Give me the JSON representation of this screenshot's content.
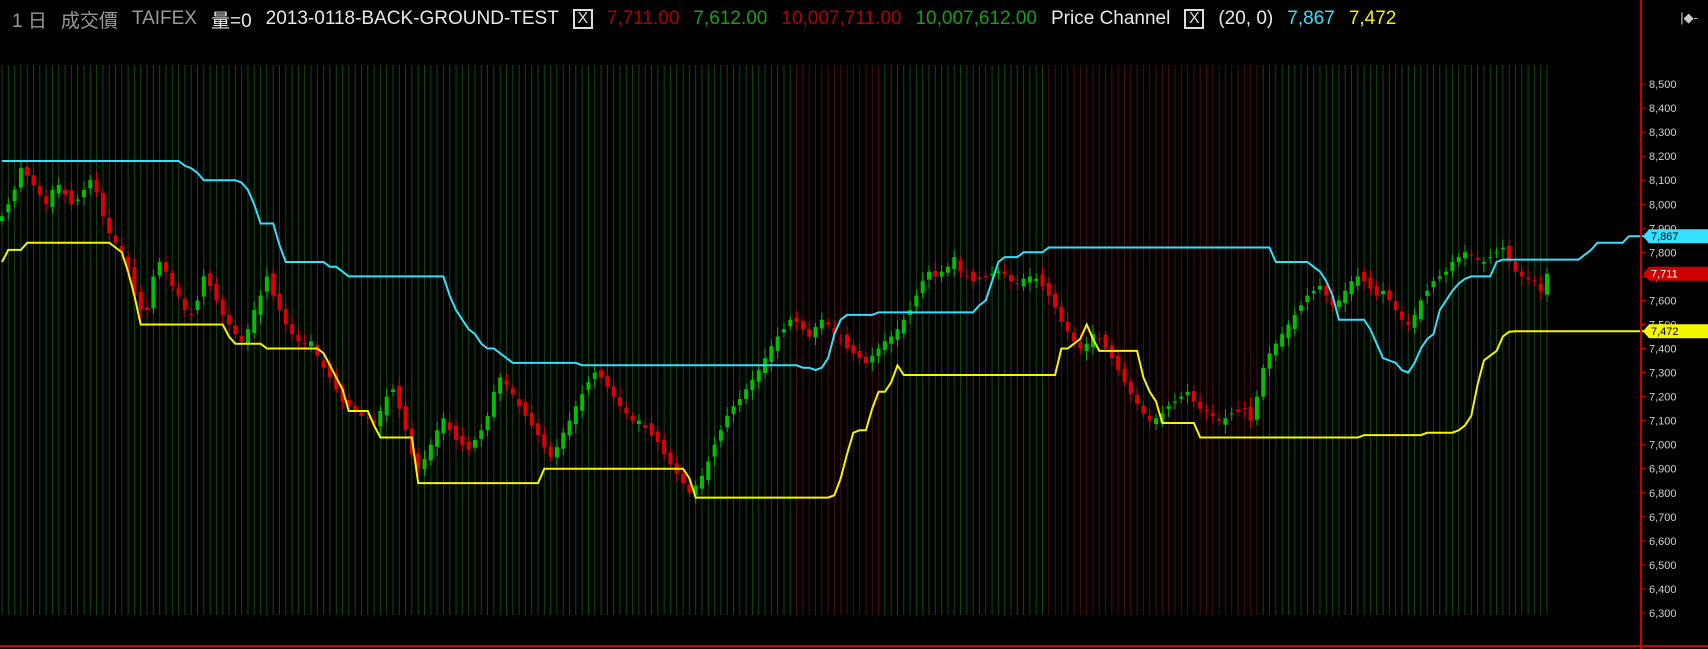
{
  "header": {
    "period": "1 日",
    "price_type": "成交價",
    "symbol": "TAIFEX",
    "volume": "量=0",
    "study1_name": "2013-0118-BACK-GROUND-TEST",
    "study1_close_box": "X",
    "study1_v1": "7,711.00",
    "study1_v2": "7,612.00",
    "study1_v3": "10,007,711.00",
    "study1_v4": "10,007,612.00",
    "study2_name": "Price Channel",
    "study2_close_box": "X",
    "study2_params": "(20,  0)",
    "study2_upper": "7,867",
    "study2_lower": "7,472"
  },
  "corner_label": "|◆-",
  "colors": {
    "up": "#00c000",
    "down": "#e00000",
    "upper_channel": "#33e0ff",
    "lower_channel": "#f5f500",
    "grid_green": "#0f4a12",
    "grid_red": "#4a1010",
    "axis": "#cc0000",
    "tick_text": "#cfcfcf",
    "header_red": "#b10000",
    "header_green": "#14a014",
    "header_white": "#e8e8e8",
    "header_gray": "#9a9a9a"
  },
  "chart_data": {
    "type": "candlestick",
    "ylim": [
      6250,
      8600
    ],
    "yticks": [
      "8,500",
      "8,400",
      "8,300",
      "8,200",
      "8,100",
      "8,000",
      "7,900",
      "7,800",
      "7,700",
      "7,600",
      "7,500",
      "7,400",
      "7,300",
      "7,200",
      "7,100",
      "7,000",
      "6,900",
      "6,800",
      "6,700",
      "6,600",
      "6,500",
      "6,400",
      "6,300"
    ],
    "ytick_values": [
      8500,
      8400,
      8300,
      8200,
      8100,
      8000,
      7900,
      7800,
      7700,
      7600,
      7500,
      7400,
      7300,
      7200,
      7100,
      7000,
      6900,
      6800,
      6700,
      6600,
      6500,
      6400,
      6300
    ],
    "closes": [
      7950,
      8000,
      8060,
      8150,
      8120,
      8080,
      8040,
      8000,
      8060,
      8080,
      8040,
      8000,
      8020,
      8060,
      8100,
      8050,
      7950,
      7880,
      7840,
      7800,
      7720,
      7620,
      7560,
      7560,
      7700,
      7760,
      7720,
      7660,
      7620,
      7560,
      7540,
      7600,
      7700,
      7660,
      7600,
      7540,
      7500,
      7460,
      7430,
      7480,
      7560,
      7620,
      7700,
      7620,
      7560,
      7500,
      7460,
      7430,
      7420,
      7430,
      7370,
      7320,
      7280,
      7230,
      7180,
      7160,
      7140,
      7120,
      7110,
      7090,
      7140,
      7200,
      7230,
      7150,
      7060,
      6960,
      6900,
      6940,
      7000,
      7060,
      7110,
      7060,
      7020,
      7000,
      6980,
      7020,
      7060,
      7120,
      7220,
      7280,
      7250,
      7210,
      7160,
      7120,
      7080,
      7040,
      6990,
      6950,
      6990,
      7050,
      7100,
      7160,
      7210,
      7260,
      7300,
      7280,
      7240,
      7200,
      7160,
      7130,
      7100,
      7100,
      7070,
      7040,
      7010,
      6960,
      6920,
      6880,
      6840,
      6800,
      6830,
      6870,
      6930,
      7000,
      7060,
      7120,
      7160,
      7190,
      7230,
      7270,
      7310,
      7360,
      7410,
      7450,
      7480,
      7520,
      7510,
      7480,
      7450,
      7490,
      7520,
      7500,
      7460,
      7440,
      7400,
      7380,
      7360,
      7340,
      7370,
      7400,
      7430,
      7450,
      7480,
      7520,
      7560,
      7620,
      7680,
      7720,
      7700,
      7720,
      7740,
      7780,
      7720,
      7700,
      7680,
      7690,
      7700,
      7710,
      7720,
      7710,
      7680,
      7670,
      7690,
      7700,
      7690,
      7660,
      7620,
      7570,
      7510,
      7470,
      7430,
      7400,
      7420,
      7460,
      7440,
      7400,
      7360,
      7310,
      7260,
      7210,
      7170,
      7130,
      7100,
      7110,
      7130,
      7160,
      7180,
      7200,
      7220,
      7180,
      7150,
      7140,
      7120,
      7100,
      7110,
      7130,
      7140,
      7150,
      7100,
      7200,
      7320,
      7380,
      7420,
      7460,
      7500,
      7540,
      7580,
      7620,
      7640,
      7660,
      7620,
      7580,
      7600,
      7640,
      7680,
      7700,
      7680,
      7650,
      7620,
      7640,
      7600,
      7560,
      7520,
      7500,
      7540,
      7600,
      7640,
      7680,
      7700,
      7720,
      7760,
      7780,
      7800,
      7790,
      7770,
      7760,
      7780,
      7800,
      7820,
      7760,
      7720,
      7700,
      7690,
      7680,
      7640,
      7711
    ],
    "upper": [
      8180,
      8180,
      8180,
      8180,
      8180,
      8180,
      8180,
      8180,
      8180,
      8180,
      8180,
      8180,
      8180,
      8180,
      8180,
      8180,
      8180,
      8180,
      8180,
      8180,
      8180,
      8180,
      8180,
      8180,
      8180,
      8180,
      8180,
      8180,
      8180,
      8160,
      8150,
      8130,
      8100,
      8100,
      8100,
      8100,
      8100,
      8100,
      8090,
      8060,
      8000,
      7920,
      7920,
      7920,
      7830,
      7760,
      7760,
      7760,
      7760,
      7760,
      7760,
      7760,
      7740,
      7740,
      7720,
      7700,
      7700,
      7700,
      7700,
      7700,
      7700,
      7700,
      7700,
      7700,
      7700,
      7700,
      7700,
      7700,
      7700,
      7700,
      7700,
      7620,
      7560,
      7520,
      7480,
      7460,
      7420,
      7400,
      7400,
      7380,
      7360,
      7340,
      7340,
      7340,
      7340,
      7340,
      7340,
      7340,
      7340,
      7340,
      7340,
      7340,
      7330,
      7330,
      7330,
      7330,
      7330,
      7330,
      7330,
      7330,
      7330,
      7330,
      7330,
      7330,
      7330,
      7330,
      7330,
      7330,
      7330,
      7330,
      7330,
      7330,
      7330,
      7330,
      7330,
      7330,
      7330,
      7330,
      7330,
      7330,
      7330,
      7330,
      7330,
      7330,
      7330,
      7330,
      7330,
      7320,
      7320,
      7310,
      7320,
      7360,
      7460,
      7520,
      7540,
      7540,
      7540,
      7540,
      7540,
      7550,
      7550,
      7550,
      7550,
      7550,
      7550,
      7550,
      7550,
      7550,
      7550,
      7550,
      7550,
      7550,
      7550,
      7550,
      7550,
      7580,
      7600,
      7680,
      7760,
      7780,
      7780,
      7780,
      7800,
      7800,
      7800,
      7800,
      7820,
      7820,
      7820,
      7820,
      7820,
      7820,
      7820,
      7820,
      7820,
      7820,
      7820,
      7820,
      7820,
      7820,
      7820,
      7820,
      7820,
      7820,
      7820,
      7820,
      7820,
      7820,
      7820,
      7820,
      7820,
      7820,
      7820,
      7820,
      7820,
      7820,
      7820,
      7820,
      7820,
      7820,
      7820,
      7820,
      7760,
      7760,
      7760,
      7760,
      7760,
      7760,
      7740,
      7720,
      7680,
      7620,
      7520,
      7520,
      7520,
      7520,
      7520,
      7480,
      7420,
      7360,
      7350,
      7340,
      7310,
      7300,
      7340,
      7400,
      7440,
      7460,
      7560,
      7600,
      7640,
      7670,
      7690,
      7700,
      7700,
      7700,
      7700,
      7760,
      7770,
      7770,
      7770,
      7770,
      7770,
      7770,
      7770,
      7770,
      7770,
      7770,
      7770,
      7770,
      7770,
      7790,
      7810,
      7840,
      7840,
      7840,
      7840,
      7840,
      7867,
      7867,
      7867,
      7867,
      7867,
      7867
    ],
    "lower": [
      7760,
      7810,
      7810,
      7810,
      7840,
      7840,
      7840,
      7840,
      7840,
      7840,
      7840,
      7840,
      7840,
      7840,
      7840,
      7840,
      7840,
      7840,
      7820,
      7800,
      7720,
      7620,
      7500,
      7500,
      7500,
      7500,
      7500,
      7500,
      7500,
      7500,
      7500,
      7500,
      7500,
      7500,
      7500,
      7500,
      7450,
      7420,
      7420,
      7420,
      7420,
      7420,
      7400,
      7400,
      7400,
      7400,
      7400,
      7400,
      7400,
      7400,
      7400,
      7380,
      7330,
      7280,
      7230,
      7140,
      7140,
      7140,
      7140,
      7080,
      7030,
      7030,
      7030,
      7030,
      7030,
      7030,
      6840,
      6840,
      6840,
      6840,
      6840,
      6840,
      6840,
      6840,
      6840,
      6840,
      6840,
      6840,
      6840,
      6840,
      6840,
      6840,
      6840,
      6840,
      6840,
      6840,
      6900,
      6900,
      6900,
      6900,
      6900,
      6900,
      6900,
      6900,
      6900,
      6900,
      6900,
      6900,
      6900,
      6900,
      6900,
      6900,
      6900,
      6900,
      6900,
      6900,
      6900,
      6900,
      6900,
      6860,
      6780,
      6780,
      6780,
      6780,
      6780,
      6780,
      6780,
      6780,
      6780,
      6780,
      6780,
      6780,
      6780,
      6780,
      6780,
      6780,
      6780,
      6780,
      6780,
      6780,
      6780,
      6780,
      6790,
      6860,
      6960,
      7050,
      7060,
      7060,
      7150,
      7220,
      7220,
      7260,
      7330,
      7290,
      7290,
      7290,
      7290,
      7290,
      7290,
      7290,
      7290,
      7290,
      7290,
      7290,
      7290,
      7290,
      7290,
      7290,
      7290,
      7290,
      7290,
      7290,
      7290,
      7290,
      7290,
      7290,
      7290,
      7290,
      7400,
      7400,
      7420,
      7440,
      7500,
      7440,
      7390,
      7390,
      7390,
      7390,
      7390,
      7390,
      7390,
      7280,
      7220,
      7180,
      7090,
      7090,
      7090,
      7090,
      7090,
      7090,
      7030,
      7030,
      7030,
      7030,
      7030,
      7030,
      7030,
      7030,
      7030,
      7030,
      7030,
      7030,
      7030,
      7030,
      7030,
      7030,
      7030,
      7030,
      7030,
      7030,
      7030,
      7030,
      7030,
      7030,
      7030,
      7030,
      7040,
      7040,
      7040,
      7040,
      7040,
      7040,
      7040,
      7040,
      7040,
      7040,
      7050,
      7050,
      7050,
      7050,
      7050,
      7060,
      7080,
      7120,
      7250,
      7350,
      7370,
      7390,
      7450,
      7470,
      7472,
      7472,
      7472,
      7472,
      7472,
      7472,
      7472,
      7472,
      7472,
      7472,
      7472,
      7472,
      7472,
      7472,
      7472,
      7472,
      7472,
      7472,
      7472,
      7472,
      7472,
      7472,
      7472
    ],
    "last_upper_label": "7,867",
    "last_close_label": "7,711",
    "last_lower_label": "7,472"
  }
}
